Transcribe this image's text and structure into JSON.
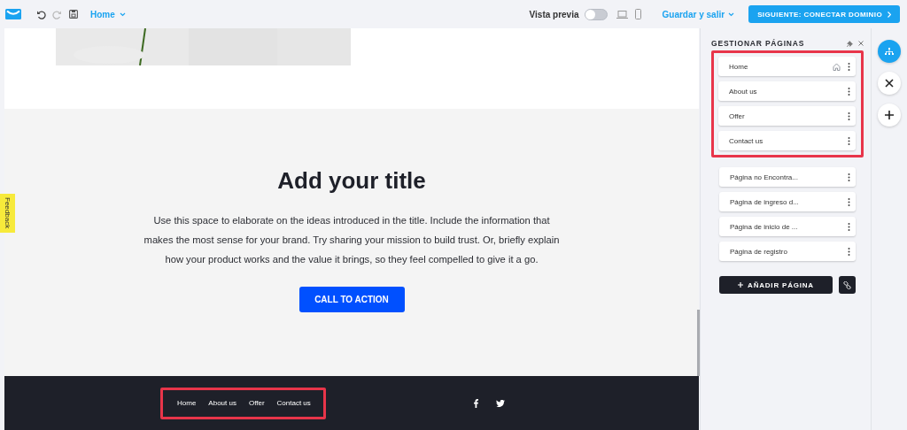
{
  "toolbar": {
    "undo_disabled": false,
    "redo_disabled": true,
    "page_selector": "Home",
    "preview_label": "Vista previa",
    "preview_on": false,
    "save_menu": "Guardar y salir",
    "next_button": "SIGUIENTE: CONECTAR DOMINIO"
  },
  "canvas": {
    "section": {
      "title": "Add your title",
      "body": "Use this space to elaborate on the ideas introduced in the title. Include the information that makes the most sense for your brand. Try sharing your mission to build trust. Or, briefly explain how your product works and the value it brings, so they feel compelled to give it a go.",
      "button": "CALL TO ACTION"
    },
    "footer": {
      "highlighted": true,
      "links": [
        "Home",
        "About us",
        "Offer",
        "Contact us"
      ]
    }
  },
  "feedback_tab": "Feedback",
  "pages_panel": {
    "title": "GESTIONAR PÁGINAS",
    "groups": [
      {
        "highlighted": true,
        "pages": [
          {
            "name": "Home",
            "is_home": true
          },
          {
            "name": "About us",
            "is_home": false
          },
          {
            "name": "Offer",
            "is_home": false
          },
          {
            "name": "Contact us",
            "is_home": false
          }
        ]
      },
      {
        "highlighted": false,
        "pages": [
          {
            "name": "Página no Encontra...",
            "is_home": false
          },
          {
            "name": "Página de ingreso d...",
            "is_home": false
          },
          {
            "name": "Página de inicio de ...",
            "is_home": false
          },
          {
            "name": "Página de registro",
            "is_home": false
          }
        ]
      }
    ],
    "add_button": "AÑADIR PÁGINA"
  },
  "rail": [
    {
      "kind": "pages",
      "selected": true
    },
    {
      "kind": "close",
      "selected": false
    },
    {
      "kind": "add",
      "selected": false
    }
  ]
}
